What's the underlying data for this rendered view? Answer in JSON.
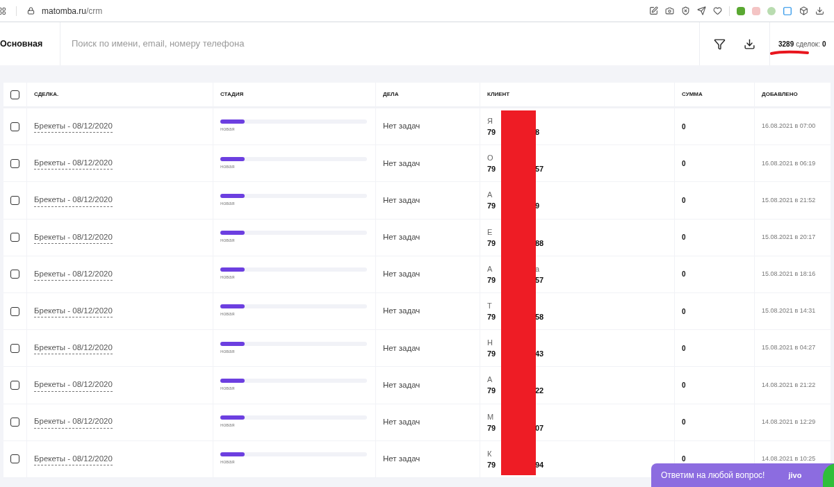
{
  "browser": {
    "url_host": "matomba.ru",
    "url_path": "/crm"
  },
  "header": {
    "pipeline": "Основная",
    "search": {
      "placeholder": "Поиск по имени, email, номеру телефона"
    },
    "count": "3289",
    "count_label": "сделок:",
    "count_value": "0"
  },
  "table": {
    "columns": [
      "СДЕЛКА.",
      "СТАДИЯ",
      "ДЕЛА",
      "КЛИЕНТ",
      "СУММА",
      "ДОБАВЛЕНО"
    ],
    "all_checked": false,
    "rows": [
      {
        "checked": false,
        "deal": "Брекеты - 08/12/2020",
        "stage": "новая",
        "level": 0.167,
        "tasks": "Нет задач",
        "name_start": "Я",
        "phone_start": "79",
        "phone_end": "8",
        "sum": "0",
        "added": "16.08.2021 в 07:00"
      },
      {
        "checked": false,
        "deal": "Брекеты - 08/12/2020",
        "stage": "новая",
        "level": 0.167,
        "tasks": "Нет задач",
        "name_start": "О",
        "phone_start": "79",
        "phone_end": "57",
        "sum": "0",
        "added": "16.08.2021 в 06:19"
      },
      {
        "checked": false,
        "deal": "Брекеты - 08/12/2020",
        "stage": "новая",
        "level": 0.167,
        "tasks": "Нет задач",
        "name_start": "А",
        "phone_start": "79",
        "phone_end": "9",
        "sum": "0",
        "added": "15.08.2021 в 21:52"
      },
      {
        "checked": false,
        "deal": "Брекеты - 08/12/2020",
        "stage": "новая",
        "level": 0.167,
        "tasks": "Нет задач",
        "name_start": "Е",
        "phone_start": "79",
        "phone_end": "88",
        "sum": "0",
        "added": "15.08.2021 в 20:17"
      },
      {
        "checked": false,
        "deal": "Брекеты - 08/12/2020",
        "stage": "новая",
        "level": 0.167,
        "tasks": "Нет задач",
        "name_start": "А",
        "name_end": "а",
        "phone_start": "79",
        "phone_end": "57",
        "sum": "0",
        "added": "15.08.2021 в 18:16"
      },
      {
        "checked": false,
        "deal": "Брекеты - 08/12/2020",
        "stage": "новая",
        "level": 0.167,
        "tasks": "Нет задач",
        "name_start": "Т",
        "phone_start": "79",
        "phone_end": "58",
        "sum": "0",
        "added": "15.08.2021 в 14:31"
      },
      {
        "checked": false,
        "deal": "Брекеты - 08/12/2020",
        "stage": "новая",
        "level": 0.167,
        "tasks": "Нет задач",
        "name_start": "Н",
        "phone_start": "79",
        "phone_end": "43",
        "sum": "0",
        "added": "15.08.2021 в 04:27"
      },
      {
        "checked": false,
        "deal": "Брекеты - 08/12/2020",
        "stage": "новая",
        "level": 0.167,
        "tasks": "Нет задач",
        "name_start": "А",
        "phone_start": "79",
        "phone_end": "22",
        "sum": "0",
        "added": "14.08.2021 в 21:22"
      },
      {
        "checked": false,
        "deal": "Брекеты - 08/12/2020",
        "stage": "новая",
        "level": 0.167,
        "tasks": "Нет задач",
        "name_start": "М",
        "phone_start": "79",
        "phone_end": "07",
        "sum": "0",
        "added": "14.08.2021 в 12:29"
      },
      {
        "checked": false,
        "deal": "Брекеты - 08/12/2020",
        "stage": "новая",
        "level": 0.167,
        "tasks": "Нет задач",
        "name_start": "К",
        "phone_start": "79",
        "phone_end": "94",
        "sum": "0",
        "added": "14.08.2021 в 10:25"
      }
    ]
  },
  "chat": {
    "text": "Ответим на любой вопрос!",
    "brand": "jivo"
  }
}
